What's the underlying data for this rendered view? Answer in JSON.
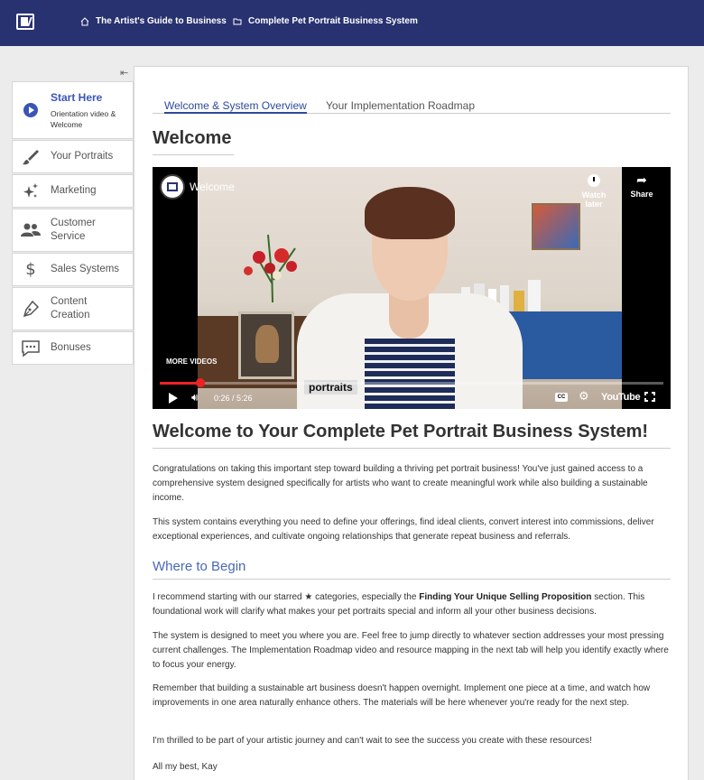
{
  "topbar": {
    "crumb1": "The Artist's Guide to Business",
    "crumb2": "Complete Pet Portrait Business System",
    "bg_color": "#283270"
  },
  "sidebar": {
    "collapse_icon": "⇤",
    "active": {
      "title": "Start Here",
      "subtitle_line1": "Orientation video &",
      "subtitle_line2": "Welcome"
    },
    "items": [
      {
        "label": "Your Portraits",
        "icon": "brush-icon"
      },
      {
        "label": "Marketing",
        "icon": "sparkle-icon"
      },
      {
        "label_line1": "Customer",
        "label_line2": "Service",
        "icon": "people-icon"
      },
      {
        "label": "Sales Systems",
        "icon": "dollar-icon"
      },
      {
        "label_line1": "Content",
        "label_line2": "Creation",
        "icon": "pen-icon"
      },
      {
        "label": "Bonuses",
        "icon": "chat-icon"
      }
    ]
  },
  "tabs": [
    {
      "label": "Welcome & System Overview",
      "active": true
    },
    {
      "label": "Your Implementation Roadmap",
      "active": false
    }
  ],
  "welcome_heading": "Welcome",
  "video": {
    "title": "Welcome",
    "watch_later": "Watch later",
    "share": "Share",
    "more_videos": "MORE VIDEOS",
    "caption": "portraits",
    "time": "0:26 / 5:26",
    "progress": 0.081,
    "youtube_label": "YouTube",
    "cc_label": "CC"
  },
  "main_heading": "Welcome to Your Complete Pet Portrait Business System!",
  "para1": "Congratulations on taking this important step toward building a thriving pet portrait business! You've just gained access to a comprehensive system designed specifically for artists who want to create meaningful work while also building a sustainable income.",
  "para2": "This system contains everything you need to define your offerings, find ideal clients, convert interest into commissions, deliver exceptional experiences, and cultivate ongoing relationships that generate repeat business and referrals.",
  "sub_heading": "Where to Begin",
  "para3_a": "I recommend starting with our starred ★ categories, especially the ",
  "para3_b": "Finding Your Unique Selling Proposition",
  "para3_c": " section. This foundational work will clarify what makes your pet portraits special and inform all your other business decisions.",
  "para4": "The system is designed to meet you where you are. Feel free to jump directly to whatever section addresses your most pressing current challenges. The Implementation Roadmap video and resource mapping in the next tab will help you identify exactly where to focus your energy.",
  "para5": "Remember that building a sustainable art business doesn't happen overnight. Implement one piece at a time, and watch how improvements in one area naturally enhance others. The materials will be here whenever you're ready for the next step.",
  "para6": "I'm thrilled to be part of your artistic journey and can't wait to see the success you create with these resources!",
  "para7": "All my best, Kay",
  "colors": {
    "accent": "#3a55b5",
    "link": "#2e4a9a",
    "subheading": "#4a68b5",
    "progress": "#e22222"
  }
}
